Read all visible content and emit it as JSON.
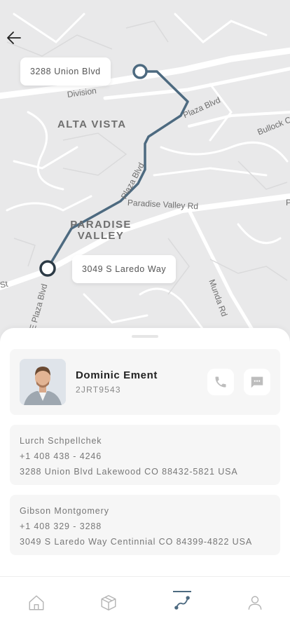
{
  "map": {
    "area_labels": {
      "alta_vista": "ALTA VISTA",
      "paradise_valley_line1": "PARADISE",
      "paradise_valley_line2": "VALLEY"
    },
    "streets": {
      "division": "Division",
      "plaza_blvd_top": "Plaza Blvd",
      "bullock": "Bullock C",
      "plaza_blvd_mid": "Plaza Blvd",
      "paradise_valley_rd": "Paradise Valley Rd",
      "paradise_valley_rd_end": "P",
      "munda_rd": "Munda Rd",
      "e_plaza_blvd": "E Plaza Blvd",
      "st": "St"
    },
    "start_address": "3288 Union Blvd",
    "end_address": "3049 S Laredo Way",
    "route_color": "#4d6a80",
    "road_color": "#ffffff",
    "land_color": "#e9e9ea"
  },
  "driver": {
    "name": "Dominic Ement",
    "id": "2JRT9543",
    "call_icon": "phone-icon",
    "message_icon": "chat-icon"
  },
  "stops": [
    {
      "name": "Lurch Schpellchek",
      "phone": "+1 408 438 - 4246",
      "address": "3288 Union Blvd Lakewood CO 88432-5821 USA"
    },
    {
      "name": "Gibson Montgomery",
      "phone": "+1 408 329 - 3288",
      "address": "3049 S Laredo Way Centinnial CO 84399-4822 USA"
    }
  ],
  "tabs": [
    {
      "icon": "home-icon",
      "active": false
    },
    {
      "icon": "package-icon",
      "active": false
    },
    {
      "icon": "route-icon",
      "active": true
    },
    {
      "icon": "user-icon",
      "active": false
    }
  ],
  "colors": {
    "accent": "#4d6a80",
    "inactive_icon": "#b4b4b4"
  }
}
